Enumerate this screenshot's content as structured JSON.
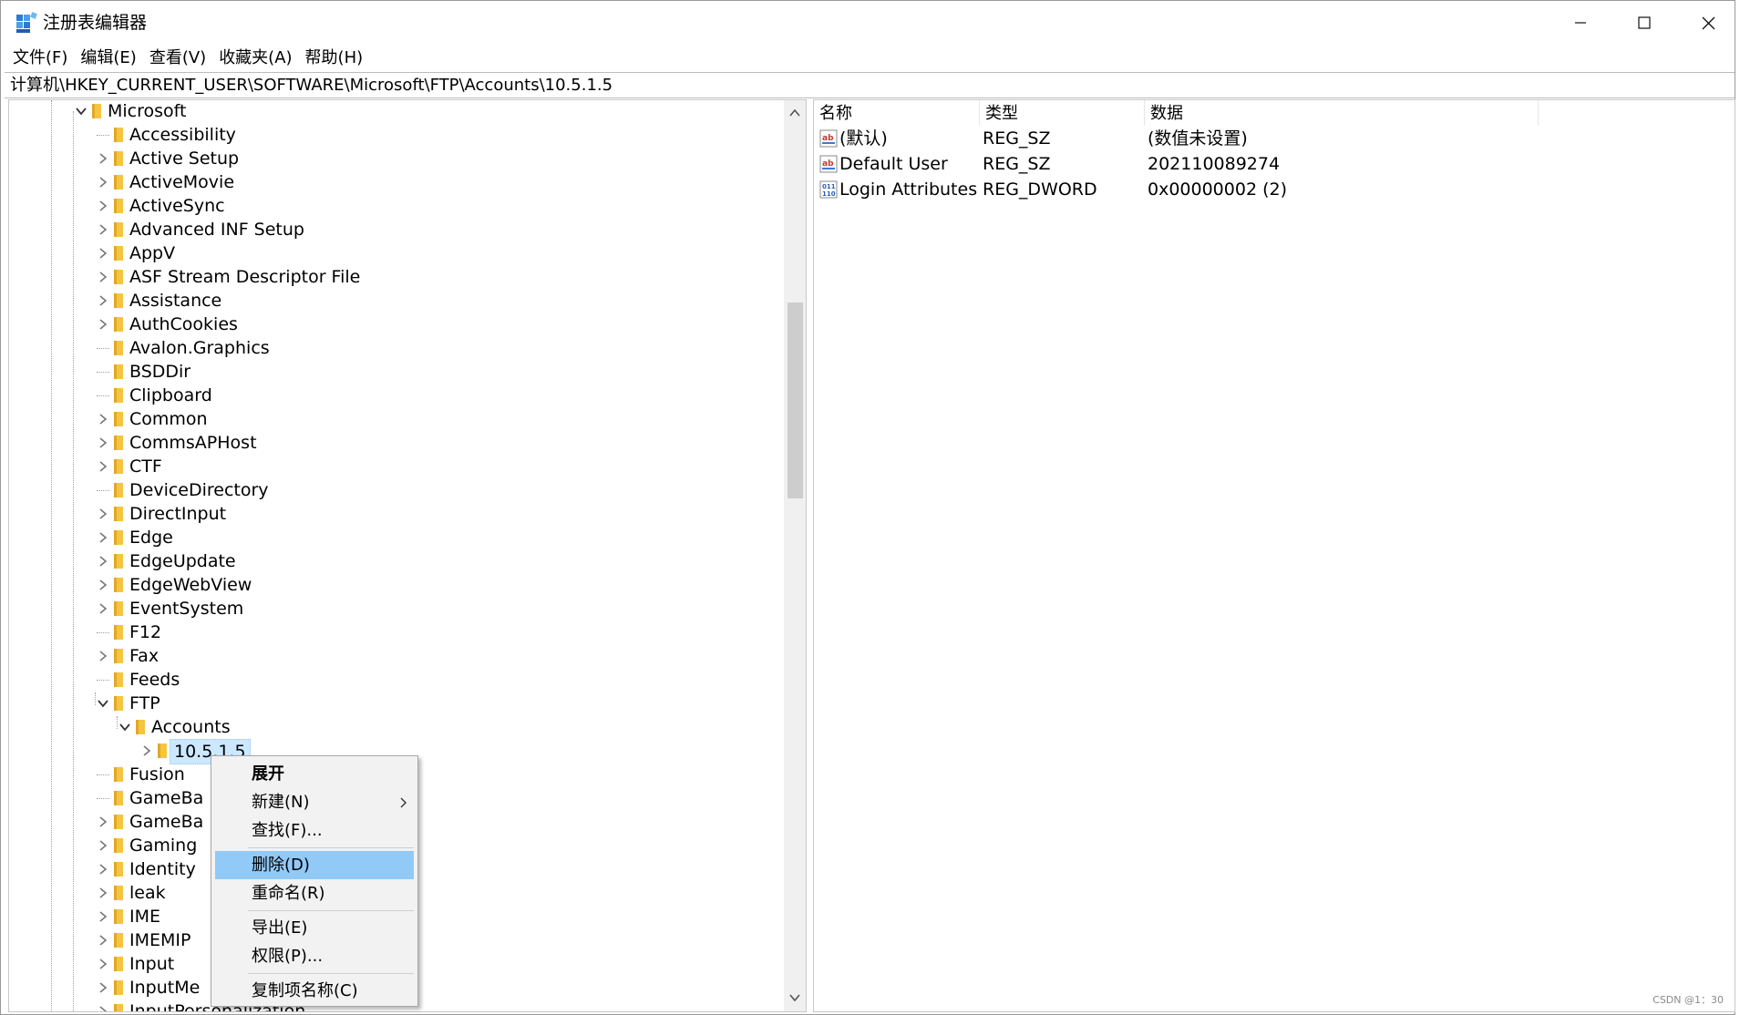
{
  "window": {
    "title": "注册表编辑器",
    "controls": {
      "minimize": "minimize",
      "maximize": "maximize",
      "close": "close"
    }
  },
  "menu": [
    "文件(F)",
    "编辑(E)",
    "查看(V)",
    "收藏夹(A)",
    "帮助(H)"
  ],
  "address": "计算机\\HKEY_CURRENT_USER\\SOFTWARE\\Microsoft\\FTP\\Accounts\\10.5.1.5",
  "tree": {
    "nodes": [
      {
        "label": "Microsoft",
        "level": 0,
        "state": "expanded"
      },
      {
        "label": "Accessibility",
        "level": 1,
        "state": "leaf"
      },
      {
        "label": "Active Setup",
        "level": 1,
        "state": "collapsed"
      },
      {
        "label": "ActiveMovie",
        "level": 1,
        "state": "collapsed"
      },
      {
        "label": "ActiveSync",
        "level": 1,
        "state": "collapsed"
      },
      {
        "label": "Advanced INF Setup",
        "level": 1,
        "state": "collapsed"
      },
      {
        "label": "AppV",
        "level": 1,
        "state": "collapsed"
      },
      {
        "label": "ASF Stream Descriptor File",
        "level": 1,
        "state": "collapsed"
      },
      {
        "label": "Assistance",
        "level": 1,
        "state": "collapsed"
      },
      {
        "label": "AuthCookies",
        "level": 1,
        "state": "collapsed"
      },
      {
        "label": "Avalon.Graphics",
        "level": 1,
        "state": "leaf"
      },
      {
        "label": "BSDDir",
        "level": 1,
        "state": "leaf"
      },
      {
        "label": "Clipboard",
        "level": 1,
        "state": "leaf"
      },
      {
        "label": "Common",
        "level": 1,
        "state": "collapsed"
      },
      {
        "label": "CommsAPHost",
        "level": 1,
        "state": "collapsed"
      },
      {
        "label": "CTF",
        "level": 1,
        "state": "collapsed"
      },
      {
        "label": "DeviceDirectory",
        "level": 1,
        "state": "leaf"
      },
      {
        "label": "DirectInput",
        "level": 1,
        "state": "collapsed"
      },
      {
        "label": "Edge",
        "level": 1,
        "state": "collapsed"
      },
      {
        "label": "EdgeUpdate",
        "level": 1,
        "state": "collapsed"
      },
      {
        "label": "EdgeWebView",
        "level": 1,
        "state": "collapsed"
      },
      {
        "label": "EventSystem",
        "level": 1,
        "state": "collapsed"
      },
      {
        "label": "F12",
        "level": 1,
        "state": "leaf"
      },
      {
        "label": "Fax",
        "level": 1,
        "state": "collapsed"
      },
      {
        "label": "Feeds",
        "level": 1,
        "state": "leaf"
      },
      {
        "label": "FTP",
        "level": 1,
        "state": "expanded"
      },
      {
        "label": "Accounts",
        "level": 2,
        "state": "expanded"
      },
      {
        "label": "10.5.1.5",
        "level": 3,
        "state": "collapsed",
        "selected": true
      },
      {
        "label": "Fusion",
        "level": 1,
        "state": "leaf"
      },
      {
        "label": "GameBa",
        "level": 1,
        "state": "leaf"
      },
      {
        "label": "GameBa",
        "level": 1,
        "state": "collapsed"
      },
      {
        "label": "Gaming",
        "level": 1,
        "state": "collapsed"
      },
      {
        "label": "Identity",
        "level": 1,
        "state": "collapsed"
      },
      {
        "label": "leak",
        "level": 1,
        "state": "collapsed"
      },
      {
        "label": "IME",
        "level": 1,
        "state": "collapsed"
      },
      {
        "label": "IMEMIP",
        "level": 1,
        "state": "collapsed"
      },
      {
        "label": "Input",
        "level": 1,
        "state": "collapsed"
      },
      {
        "label": "InputMe",
        "level": 1,
        "state": "collapsed"
      },
      {
        "label": "InputPersonalization",
        "level": 1,
        "state": "collapsed"
      }
    ]
  },
  "list": {
    "columns": [
      "名称",
      "类型",
      "数据"
    ],
    "rows": [
      {
        "icon": "string-value-icon",
        "name": "(默认)",
        "type": "REG_SZ",
        "data": "(数值未设置)"
      },
      {
        "icon": "string-value-icon",
        "name": "Default User",
        "type": "REG_SZ",
        "data": "202110089274"
      },
      {
        "icon": "dword-value-icon",
        "name": "Login Attributes",
        "type": "REG_DWORD",
        "data": "0x00000002 (2)"
      }
    ]
  },
  "context_menu": {
    "items": [
      {
        "label": "展开",
        "bold": true
      },
      {
        "label": "新建(N)",
        "submenu": true
      },
      {
        "label": "查找(F)..."
      },
      {
        "separator": true
      },
      {
        "label": "删除(D)",
        "highlighted": true
      },
      {
        "label": "重命名(R)"
      },
      {
        "separator": true
      },
      {
        "label": "导出(E)"
      },
      {
        "label": "权限(P)..."
      },
      {
        "separator": true
      },
      {
        "label": "复制项名称(C)"
      }
    ]
  },
  "footer": "CSDN @1：30",
  "colors": {
    "selection": "#cce8ff",
    "menu_highlight": "#91c9f7",
    "folder": "#f5c542",
    "accent": "#1f6fb4"
  }
}
